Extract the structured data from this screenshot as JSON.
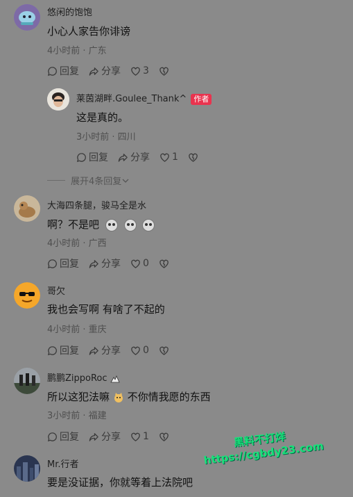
{
  "comments": [
    {
      "username": "悠闲的饱饱",
      "content": "小心人家告你诽谤",
      "meta": "4小时前 · 广东",
      "reply_label": "回复",
      "share_label": "分享",
      "likes": "3"
    },
    {
      "username": "莱茵湖畔.Goulee_Thank^",
      "author_tag": "作者",
      "content": "这是真的。",
      "meta": "3小时前 · 四川",
      "reply_label": "回复",
      "share_label": "分享",
      "likes": "1"
    },
    {
      "username": "大海四条腿，骏马全是水",
      "content": "啊？不是吧",
      "meta": "4小时前 · 广西",
      "reply_label": "回复",
      "share_label": "分享",
      "likes": "0"
    },
    {
      "username": "哥欠",
      "content": "我也会写啊 有啥了不起的",
      "meta": "4小时前 · 重庆",
      "reply_label": "回复",
      "share_label": "分享",
      "likes": "0"
    },
    {
      "username": "鹏鹏ZippoRoc",
      "content_a": "所以这犯法嘛",
      "content_b": "不你情我愿的东西",
      "meta": "3小时前 · 福建",
      "reply_label": "回复",
      "share_label": "分享",
      "likes": "1"
    },
    {
      "username": "Mr.行者",
      "content": "要是没证据，你就等着上法院吧"
    }
  ],
  "expand_replies": "展开4条回复",
  "watermark": {
    "line1": "黑料不打烊",
    "line2": "https://cgbdy23.com"
  }
}
